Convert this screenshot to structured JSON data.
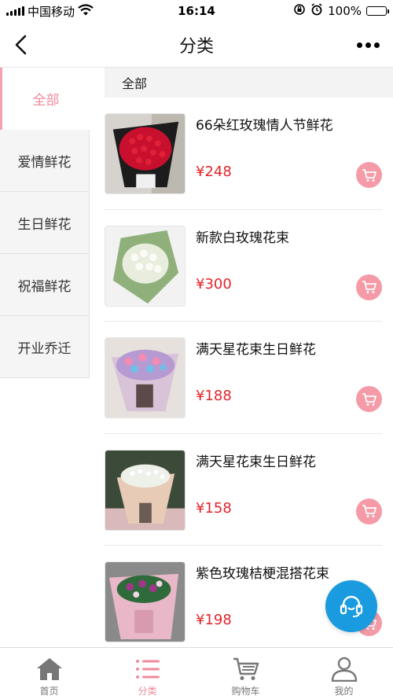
{
  "status_bar": {
    "carrier": "中国移动",
    "time": "16:14",
    "battery": "100%",
    "battery_level": 1.0
  },
  "navbar": {
    "title": "分类",
    "back_icon": "chevron-left-icon",
    "more_icon": "more-dots-icon"
  },
  "sidebar": {
    "items": [
      {
        "label": "全部",
        "active": true
      },
      {
        "label": "爱情鲜花",
        "active": false
      },
      {
        "label": "生日鲜花",
        "active": false
      },
      {
        "label": "祝福鲜花",
        "active": false
      },
      {
        "label": "开业乔迁",
        "active": false
      }
    ]
  },
  "content": {
    "section_title": "全部",
    "products": [
      {
        "name": "66朵红玫瑰情人节鲜花",
        "price": "¥248",
        "image": "red-rose-bouquet"
      },
      {
        "name": "新款白玫瑰花束",
        "price": "¥300",
        "image": "white-rose-bouquet"
      },
      {
        "name": "满天星花束生日鲜花",
        "price": "¥188",
        "image": "gypsophila-bouquet-colorful"
      },
      {
        "name": "满天星花束生日鲜花",
        "price": "¥158",
        "image": "gypsophila-bouquet-white"
      },
      {
        "name": "紫色玫瑰桔梗混搭花束",
        "price": "¥198",
        "image": "purple-rose-bouquet"
      }
    ]
  },
  "floating_button": {
    "icon": "customer-service-headset-icon"
  },
  "tabbar": {
    "tabs": [
      {
        "label": "首页",
        "icon": "home-icon",
        "active": false
      },
      {
        "label": "分类",
        "icon": "category-list-icon",
        "active": true
      },
      {
        "label": "购物车",
        "icon": "shopping-cart-icon",
        "active": false
      },
      {
        "label": "我的",
        "icon": "user-icon",
        "active": false
      }
    ]
  },
  "colors": {
    "accent_pink": "#f08a9a",
    "cart_button": "#f59aa7",
    "price_red": "#e3232a",
    "service_blue": "#1a9be0"
  }
}
